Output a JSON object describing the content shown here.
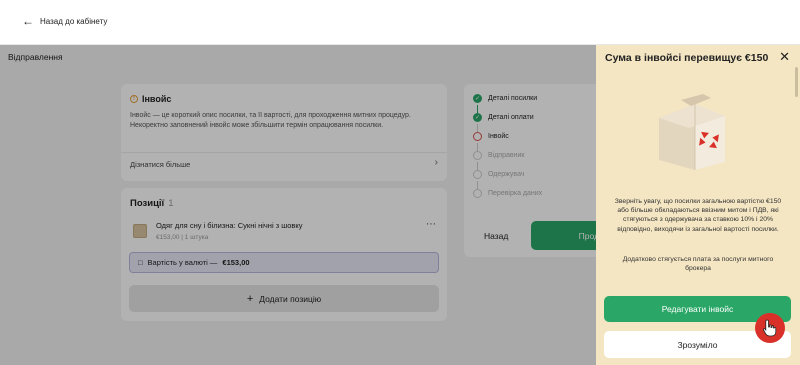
{
  "topbar": {
    "back_label": "Назад до кабінету"
  },
  "page": {
    "section_title": "Відправлення"
  },
  "invoice": {
    "title": "Інвойс",
    "description": "Інвойс — це короткий опис посилки, та її вартості, для проходження митних процедур. Некоректно заповнений інвойс може збільшити термін опрацювання посилки.",
    "learn_more": "Дізнатися більше"
  },
  "positions": {
    "title": "Позиції",
    "count": "1",
    "items": [
      {
        "name": "Одяг для сну і білизна: Сукні нічні з шовку",
        "meta": "€153,00 | 1 штука"
      }
    ],
    "currency_label": "Вартість у валюті —",
    "currency_value": "€153,00",
    "add_label": "Додати позицію"
  },
  "steps": [
    {
      "label": "Деталі посилки",
      "state": "done"
    },
    {
      "label": "Деталі оплати",
      "state": "done"
    },
    {
      "label": "Інвойс",
      "state": "current"
    },
    {
      "label": "Відправник",
      "state": "todo"
    },
    {
      "label": "Одержувач",
      "state": "todo"
    },
    {
      "label": "Перевірка даних",
      "state": "todo"
    }
  ],
  "nav": {
    "back_label": "Назад",
    "next_label": "Прод"
  },
  "panel": {
    "title": "Сума в інвойсі перевищує €150",
    "text1": "Зверніть увагу, що посилки загальною вартістю €150 або більше обкладаються ввізним митом і ПДВ, які стягуються з одержувача за ставкою 10% і 20% відповідно, виходячи із загальної вартості посилки.",
    "text2": "Додатково стягується плата за послуги митного брокера",
    "edit_label": "Редагувати інвойс",
    "ok_label": "Зрозуміло"
  },
  "colors": {
    "brand_green": "#2aa767",
    "panel_bg": "#f4e6c3",
    "brand_red": "#d9302a",
    "currency_bg": "#e8e8f7"
  },
  "icons": [
    "arrow-left-icon",
    "info-icon",
    "chevron-right-icon",
    "more-dots-icon",
    "currency-icon",
    "plus-icon",
    "check-icon",
    "close-icon",
    "box-illustration",
    "hand-cursor-icon"
  ]
}
